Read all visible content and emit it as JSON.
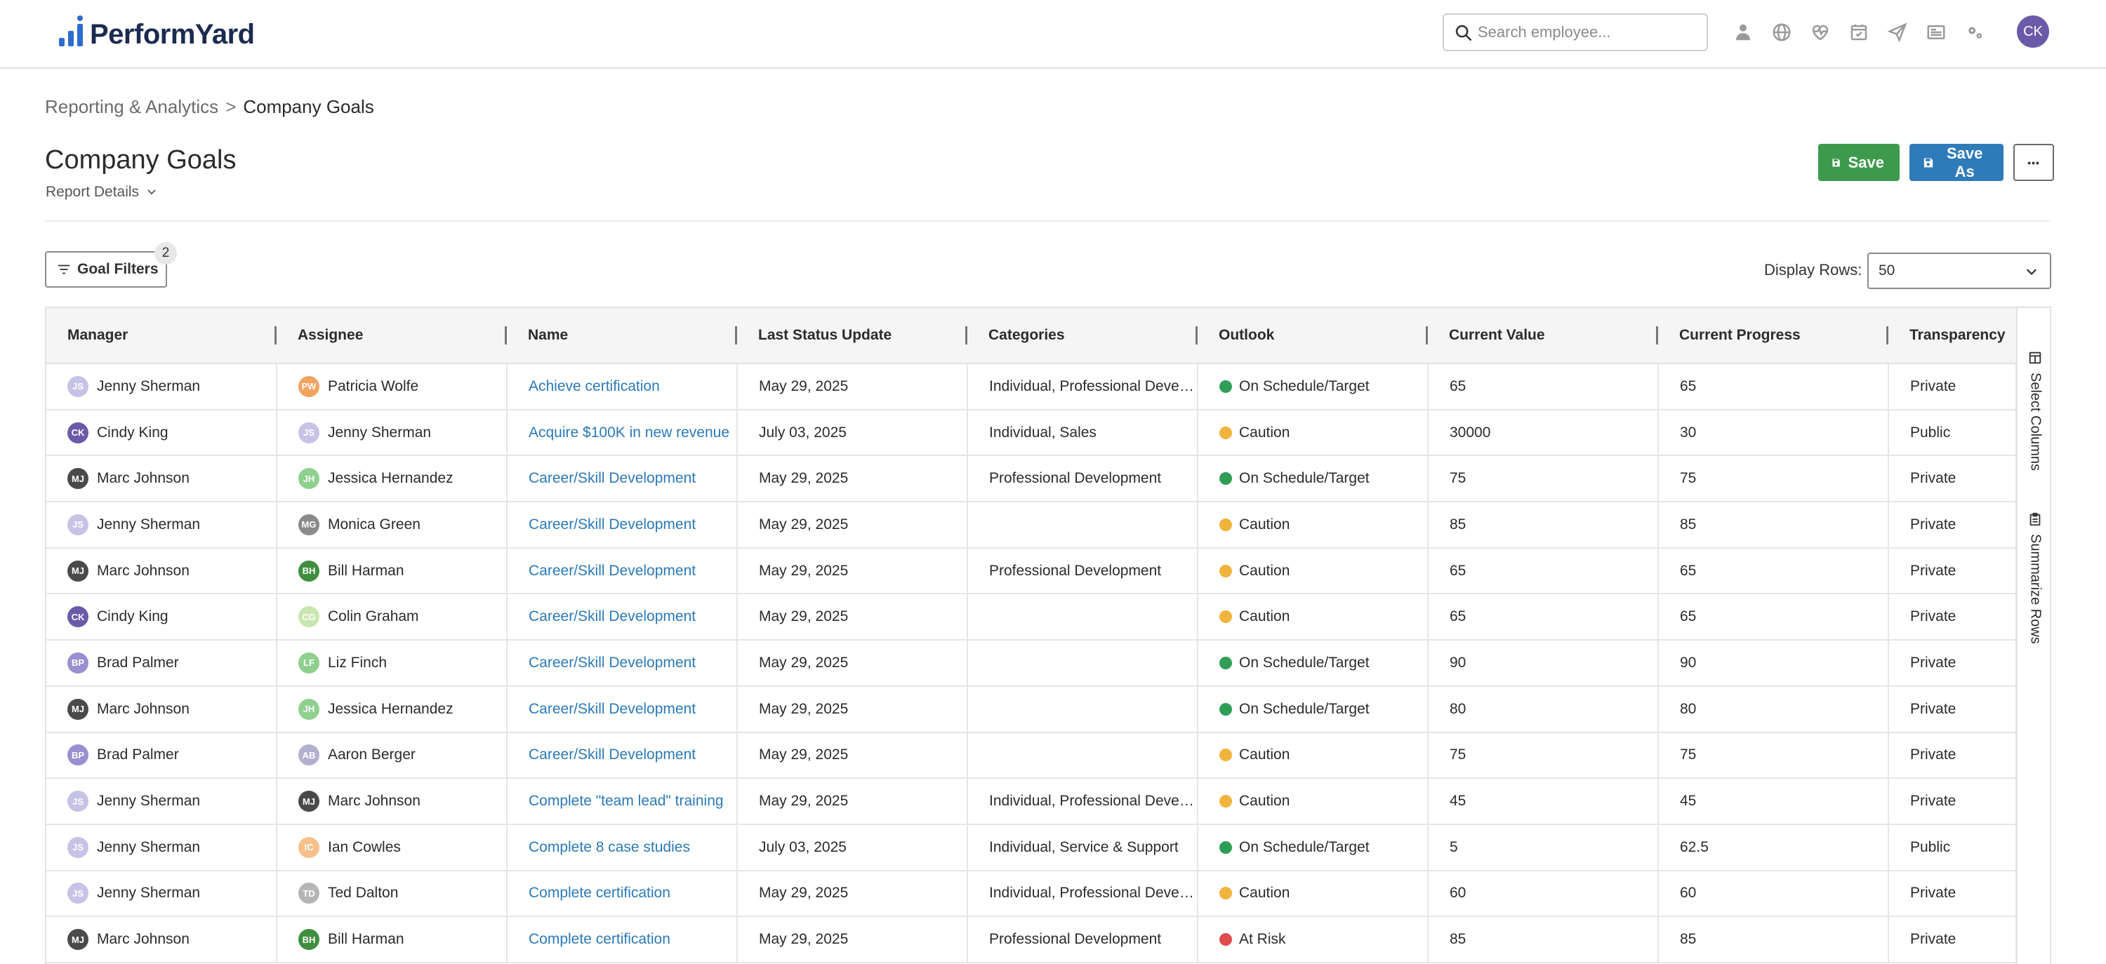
{
  "app": {
    "logo_text": "PerformYard",
    "brand_color": "#2d6bcf"
  },
  "search": {
    "placeholder": "Search employee..."
  },
  "top_icons": [
    "person-icon",
    "globe-icon",
    "heart-pulse-icon",
    "calendar-check-icon",
    "paper-plane-icon",
    "news-icon",
    "gears-icon"
  ],
  "user": {
    "initials": "CK",
    "color": "#6a5aa8"
  },
  "breadcrumb": {
    "parent": "Reporting & Analytics",
    "separator": ">",
    "current": "Company Goals"
  },
  "page": {
    "title": "Company Goals",
    "report_details_label": "Report Details"
  },
  "toolbar": {
    "save_label": "Save",
    "save_as_label": "Save As",
    "more_label": "•••",
    "save_color": "#3d9a4c",
    "save_as_color": "#2f7bb9"
  },
  "filters": {
    "label": "Goal Filters",
    "count": "2"
  },
  "display_rows": {
    "label": "Display Rows:",
    "value": "50"
  },
  "side_panel": {
    "select_columns": "Select Columns",
    "summarize_rows": "Summarize Rows"
  },
  "table": {
    "columns": [
      "Manager",
      "Assignee",
      "Name",
      "Last Status Update",
      "Categories",
      "Outlook",
      "Current Value",
      "Current Progress",
      "Transparency"
    ],
    "outlook_colors": {
      "On Schedule/Target": "#2e9e57",
      "Caution": "#f0b43c",
      "At Risk": "#e04b4b"
    },
    "rows": [
      {
        "manager": "Jenny Sherman",
        "manager_initials": "JS",
        "manager_color": "#c7c3e6",
        "assignee": "Patricia Wolfe",
        "assignee_initials": "PW",
        "assignee_color": "#f3a25f",
        "name": "Achieve certification",
        "last_update": "May 29, 2025",
        "categories": "Individual, Professional Development",
        "outlook": "On Schedule/Target",
        "current_value": "65",
        "current_progress": "65",
        "transparency": "Private"
      },
      {
        "manager": "Cindy King",
        "manager_initials": "CK",
        "manager_color": "#6a5aa8",
        "assignee": "Jenny Sherman",
        "assignee_initials": "JS",
        "assignee_color": "#c7c3e6",
        "name": "Acquire $100K in new revenue",
        "last_update": "July 03, 2025",
        "categories": "Individual, Sales",
        "outlook": "Caution",
        "current_value": "30000",
        "current_progress": "30",
        "transparency": "Public"
      },
      {
        "manager": "Marc Johnson",
        "manager_initials": "MJ",
        "manager_color": "#4a4a4a",
        "assignee": "Jessica Hernandez",
        "assignee_initials": "JH",
        "assignee_color": "#8fd08f",
        "name": "Career/Skill Development",
        "last_update": "May 29, 2025",
        "categories": "Professional Development",
        "outlook": "On Schedule/Target",
        "current_value": "75",
        "current_progress": "75",
        "transparency": "Private"
      },
      {
        "manager": "Jenny Sherman",
        "manager_initials": "JS",
        "manager_color": "#c7c3e6",
        "assignee": "Monica Green",
        "assignee_initials": "MG",
        "assignee_color": "#8a8a8a",
        "name": "Career/Skill Development",
        "last_update": "May 29, 2025",
        "categories": "",
        "outlook": "Caution",
        "current_value": "85",
        "current_progress": "85",
        "transparency": "Private"
      },
      {
        "manager": "Marc Johnson",
        "manager_initials": "MJ",
        "manager_color": "#4a4a4a",
        "assignee": "Bill Harman",
        "assignee_initials": "BH",
        "assignee_color": "#3e8e3e",
        "name": "Career/Skill Development",
        "last_update": "May 29, 2025",
        "categories": "Professional Development",
        "outlook": "Caution",
        "current_value": "65",
        "current_progress": "65",
        "transparency": "Private"
      },
      {
        "manager": "Cindy King",
        "manager_initials": "CK",
        "manager_color": "#6a5aa8",
        "assignee": "Colin Graham",
        "assignee_initials": "CG",
        "assignee_color": "#c9e6b0",
        "name": "Career/Skill Development",
        "last_update": "May 29, 2025",
        "categories": "",
        "outlook": "Caution",
        "current_value": "65",
        "current_progress": "65",
        "transparency": "Private"
      },
      {
        "manager": "Brad Palmer",
        "manager_initials": "BP",
        "manager_color": "#9a8fd0",
        "assignee": "Liz Finch",
        "assignee_initials": "LF",
        "assignee_color": "#8fd08f",
        "name": "Career/Skill Development",
        "last_update": "May 29, 2025",
        "categories": "",
        "outlook": "On Schedule/Target",
        "current_value": "90",
        "current_progress": "90",
        "transparency": "Private"
      },
      {
        "manager": "Marc Johnson",
        "manager_initials": "MJ",
        "manager_color": "#4a4a4a",
        "assignee": "Jessica Hernandez",
        "assignee_initials": "JH",
        "assignee_color": "#8fd08f",
        "name": "Career/Skill Development",
        "last_update": "May 29, 2025",
        "categories": "",
        "outlook": "On Schedule/Target",
        "current_value": "80",
        "current_progress": "80",
        "transparency": "Private"
      },
      {
        "manager": "Brad Palmer",
        "manager_initials": "BP",
        "manager_color": "#9a8fd0",
        "assignee": "Aaron Berger",
        "assignee_initials": "AB",
        "assignee_color": "#b3b0cf",
        "name": "Career/Skill Development",
        "last_update": "May 29, 2025",
        "categories": "",
        "outlook": "Caution",
        "current_value": "75",
        "current_progress": "75",
        "transparency": "Private"
      },
      {
        "manager": "Jenny Sherman",
        "manager_initials": "JS",
        "manager_color": "#c7c3e6",
        "assignee": "Marc Johnson",
        "assignee_initials": "MJ",
        "assignee_color": "#4a4a4a",
        "name": "Complete \"team lead\" training",
        "last_update": "May 29, 2025",
        "categories": "Individual, Professional Development",
        "outlook": "Caution",
        "current_value": "45",
        "current_progress": "45",
        "transparency": "Private"
      },
      {
        "manager": "Jenny Sherman",
        "manager_initials": "JS",
        "manager_color": "#c7c3e6",
        "assignee": "Ian Cowles",
        "assignee_initials": "IC",
        "assignee_color": "#f6c08c",
        "name": "Complete 8 case studies",
        "last_update": "July 03, 2025",
        "categories": "Individual, Service & Support",
        "outlook": "On Schedule/Target",
        "current_value": "5",
        "current_progress": "62.5",
        "transparency": "Public"
      },
      {
        "manager": "Jenny Sherman",
        "manager_initials": "JS",
        "manager_color": "#c7c3e6",
        "assignee": "Ted Dalton",
        "assignee_initials": "TD",
        "assignee_color": "#b5b5b5",
        "name": "Complete certification",
        "last_update": "May 29, 2025",
        "categories": "Individual, Professional Development",
        "outlook": "Caution",
        "current_value": "60",
        "current_progress": "60",
        "transparency": "Private"
      },
      {
        "manager": "Marc Johnson",
        "manager_initials": "MJ",
        "manager_color": "#4a4a4a",
        "assignee": "Bill Harman",
        "assignee_initials": "BH",
        "assignee_color": "#3e8e3e",
        "name": "Complete certification",
        "last_update": "May 29, 2025",
        "categories": "Professional Development",
        "outlook": "At Risk",
        "current_value": "85",
        "current_progress": "85",
        "transparency": "Private"
      }
    ]
  }
}
